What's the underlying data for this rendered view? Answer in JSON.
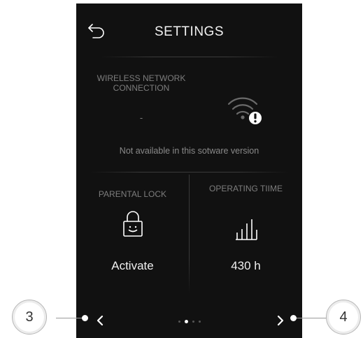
{
  "header": {
    "title": "SETTINGS"
  },
  "wireless": {
    "label": "WIRELESS NETWORK CONNECTION",
    "value": "-",
    "note": "Not available in this sotware version"
  },
  "parental_lock": {
    "label": "PARENTAL LOCK",
    "action": "Activate"
  },
  "operating_time": {
    "label": "OPERATING TIIME",
    "value": "430 h"
  },
  "pagination": {
    "total": 4,
    "current": 2
  },
  "callouts": {
    "left": "3",
    "right": "4"
  },
  "icons": {
    "back": "back-arrow-icon",
    "wifi": "wifi-warning-icon",
    "lock": "padlock-smile-icon",
    "chart": "bar-chart-icon",
    "prev": "chevron-left-icon",
    "next": "chevron-right-icon"
  },
  "colors": {
    "screen_bg": "#111111",
    "text_primary": "#f0f0f0",
    "text_secondary": "#7d7d7d",
    "divider": "#3a3a3a"
  }
}
